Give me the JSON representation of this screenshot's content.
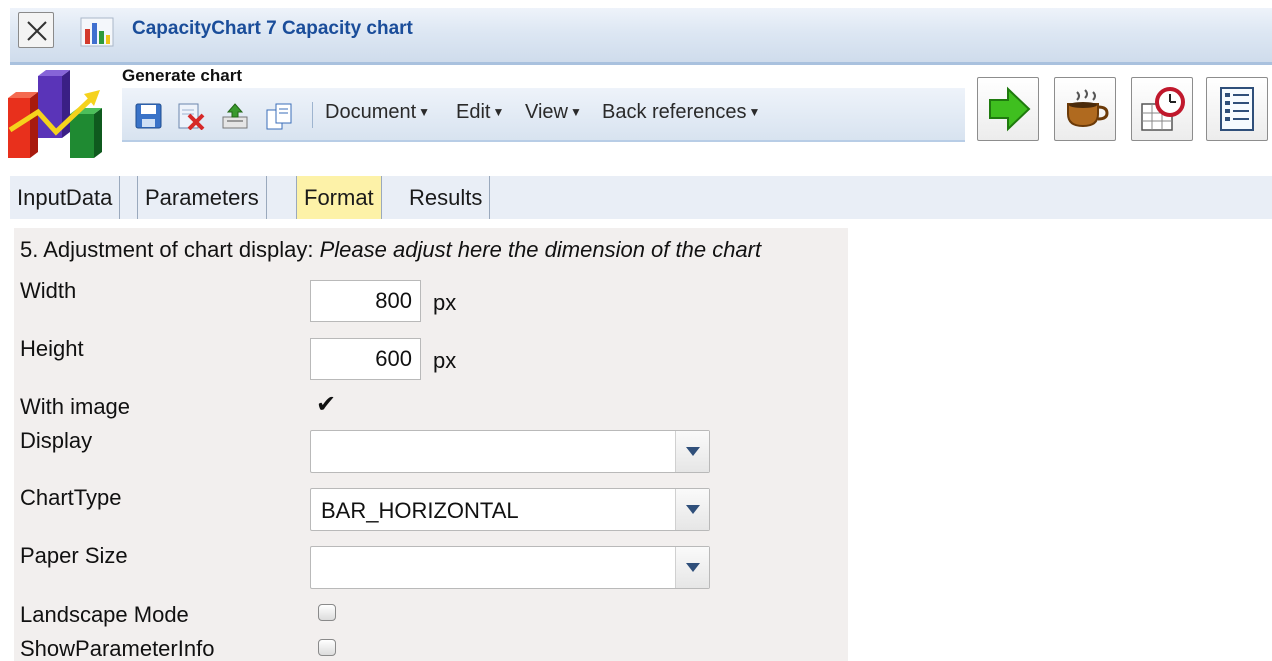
{
  "window": {
    "title": "CapacityChart 7 Capacity chart"
  },
  "toolbar": {
    "section_label": "Generate chart",
    "menus": [
      {
        "label": "Document"
      },
      {
        "label": "Edit"
      },
      {
        "label": "View"
      },
      {
        "label": "Back references"
      }
    ],
    "icons": [
      "save-icon",
      "delete-icon",
      "upload-icon",
      "copy-icon"
    ],
    "big_buttons": [
      "run-arrow-icon",
      "coffee-icon",
      "schedule-clock-icon",
      "report-list-icon"
    ]
  },
  "tabs": [
    {
      "label": "InputData",
      "active": false
    },
    {
      "label": "Parameters",
      "active": false
    },
    {
      "label": "Format",
      "active": true
    },
    {
      "label": "Results",
      "active": false
    }
  ],
  "form": {
    "section_title": "5. Adjustment of chart display: ",
    "section_hint": "Please adjust here the dimension of the chart",
    "width": {
      "label": "Width",
      "value": "800",
      "unit": "px"
    },
    "height": {
      "label": "Height",
      "value": "600",
      "unit": "px"
    },
    "with_image": {
      "label": "With image",
      "checked": true
    },
    "display": {
      "label": "Display",
      "value": ""
    },
    "chart_type": {
      "label": "ChartType",
      "value": "BAR_HORIZONTAL"
    },
    "paper_size": {
      "label": "Paper Size",
      "value": ""
    },
    "landscape_mode": {
      "label": "Landscape Mode",
      "checked": false
    },
    "show_parameter_info": {
      "label": "ShowParameterInfo",
      "checked": false
    }
  },
  "colors": {
    "title": "#1a4d9a",
    "active_tab": "#fdf2a8",
    "run_arrow": "#3fbf1f"
  }
}
